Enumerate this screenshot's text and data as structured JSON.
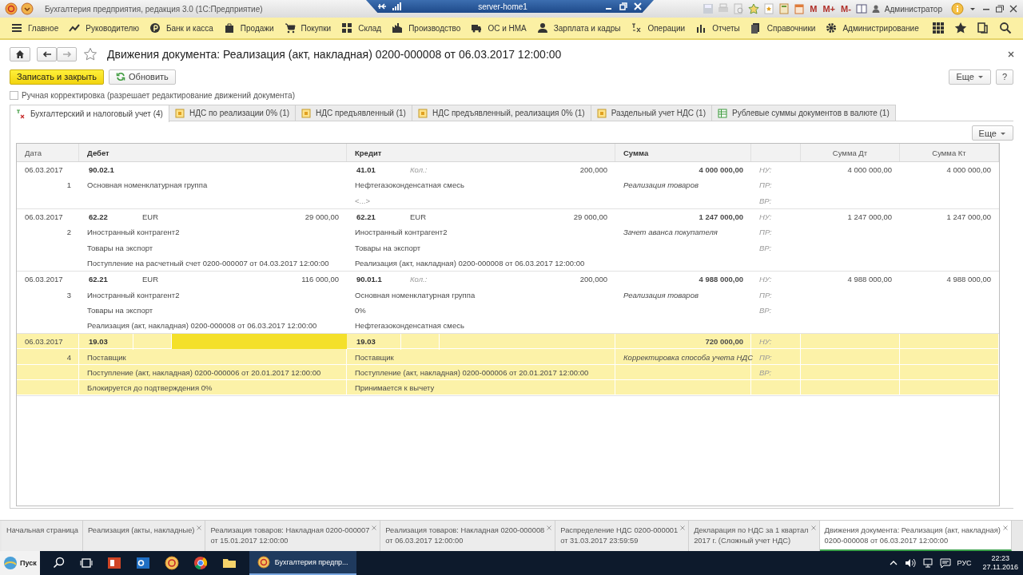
{
  "window": {
    "title": "Бухгалтерия предприятия, редакция 3.0  (1С:Предприятие)",
    "remote_host": "server-home1",
    "memory_buttons": [
      "M",
      "M+",
      "M-"
    ],
    "user": "Администратор"
  },
  "sections": [
    "Главное",
    "Руководителю",
    "Банк и касса",
    "Продажи",
    "Покупки",
    "Склад",
    "Производство",
    "ОС и НМА",
    "Зарплата и кадры",
    "Операции",
    "Отчеты",
    "Справочники",
    "Администрирование"
  ],
  "form": {
    "title": "Движения документа: Реализация (акт, накладная) 0200-000008 от 06.03.2017 12:00:00",
    "favorite": false,
    "buttons": {
      "save_close": "Записать и закрыть",
      "refresh": "Обновить",
      "more": "Еще",
      "help": "?",
      "table_more": "Еще"
    },
    "manual_edit": {
      "label": "Ручная корректировка (разрешает редактирование движений документа)",
      "checked": false
    },
    "tabs": [
      {
        "label": "Бухгалтерский и налоговый учет (4)",
        "selected": true
      },
      {
        "label": "НДС по реализации 0% (1)",
        "selected": false
      },
      {
        "label": "НДС предъявленный (1)",
        "selected": false
      },
      {
        "label": "НДС предъявленный, реализация 0% (1)",
        "selected": false
      },
      {
        "label": "Раздельный учет НДС (1)",
        "selected": false
      },
      {
        "label": "Рублевые суммы документов в валюте (1)",
        "selected": false
      }
    ],
    "table": {
      "columns": [
        "Дата",
        "Дебет",
        "Кредит",
        "Сумма",
        "",
        "Сумма Дт",
        "Сумма Кт"
      ],
      "entries": [
        {
          "date": "06.03.2017",
          "number": "1",
          "selected": false,
          "debit": {
            "account": "90.02.1",
            "lines": [
              {
                "text": "Основная номенклатурная группа",
                "muted": false
              }
            ]
          },
          "credit": {
            "account": "41.01",
            "qty_label": "Кол.:",
            "qty": "200,000",
            "lines": [
              {
                "text": "Нефтегазоконденсатная смесь",
                "muted": false
              },
              {
                "text": "<...>",
                "muted": true
              }
            ]
          },
          "sum": "4 000 000,00",
          "content": "Реализация товаров",
          "tax_labels": [
            "НУ:",
            "ПР:",
            "ВР:"
          ],
          "sum_dt": "4 000 000,00",
          "sum_kt": "4 000 000,00"
        },
        {
          "date": "06.03.2017",
          "number": "2",
          "selected": false,
          "debit": {
            "account": "62.22",
            "currency": "EUR",
            "amount": "29 000,00",
            "lines": [
              {
                "text": "Иностранный контрагент2",
                "muted": false
              },
              {
                "text": "Товары на экспорт",
                "muted": false
              },
              {
                "text": "Поступление на расчетный счет 0200-000007 от 04.03.2017 12:00:00",
                "muted": false
              }
            ]
          },
          "credit": {
            "account": "62.21",
            "currency": "EUR",
            "amount": "29 000,00",
            "lines": [
              {
                "text": "Иностранный контрагент2",
                "muted": false
              },
              {
                "text": "Товары на экспорт",
                "muted": false
              },
              {
                "text": "Реализация (акт, накладная) 0200-000008 от 06.03.2017 12:00:00",
                "muted": false
              }
            ]
          },
          "sum": "1 247 000,00",
          "content": "Зачет аванса покупателя",
          "tax_labels": [
            "НУ:",
            "ПР:",
            "ВР:"
          ],
          "sum_dt": "1 247 000,00",
          "sum_kt": "1 247 000,00"
        },
        {
          "date": "06.03.2017",
          "number": "3",
          "selected": false,
          "debit": {
            "account": "62.21",
            "currency": "EUR",
            "amount": "116 000,00",
            "lines": [
              {
                "text": "Иностранный контрагент2",
                "muted": false
              },
              {
                "text": "Товары на экспорт",
                "muted": false
              },
              {
                "text": "Реализация (акт, накладная) 0200-000008 от 06.03.2017 12:00:00",
                "muted": false
              }
            ]
          },
          "credit": {
            "account": "90.01.1",
            "qty_label": "Кол.:",
            "qty": "200,000",
            "lines": [
              {
                "text": "Основная номенклатурная группа",
                "muted": false
              },
              {
                "text": "0%",
                "muted": false
              },
              {
                "text": "Нефтегазоконденсатная смесь",
                "muted": false
              }
            ]
          },
          "sum": "4 988 000,00",
          "content": "Реализация товаров",
          "tax_labels": [
            "НУ:",
            "ПР:",
            "ВР:"
          ],
          "sum_dt": "4 988 000,00",
          "sum_kt": "4 988 000,00"
        },
        {
          "date": "06.03.2017",
          "number": "4",
          "selected": true,
          "debit": {
            "account": "19.03",
            "lines": [
              {
                "text": "Поставщик",
                "muted": false
              },
              {
                "text": "Поступление (акт, накладная) 0200-000006 от 20.01.2017 12:00:00",
                "muted": false
              },
              {
                "text": "Блокируется до подтверждения 0%",
                "muted": false
              }
            ]
          },
          "credit": {
            "account": "19.03",
            "lines": [
              {
                "text": "Поставщик",
                "muted": false
              },
              {
                "text": "Поступление (акт, накладная) 0200-000006 от 20.01.2017 12:00:00",
                "muted": false
              },
              {
                "text": "Принимается к вычету",
                "muted": false
              }
            ]
          },
          "sum": "720 000,00",
          "content": "Корректировка способа учета НДС",
          "tax_labels": [
            "НУ:",
            "ПР:",
            "ВР:"
          ]
        }
      ]
    }
  },
  "open_windows": [
    {
      "lines": [
        "Начальная страница"
      ],
      "closable": false,
      "selected": false
    },
    {
      "lines": [
        "Реализация (акты, накладные)"
      ],
      "closable": true,
      "selected": false
    },
    {
      "lines": [
        "Реализация товаров: Накладная 0200-000007",
        "от 15.01.2017 12:00:00"
      ],
      "closable": true,
      "selected": false
    },
    {
      "lines": [
        "Реализация товаров: Накладная 0200-000008",
        "от 06.03.2017 12:00:00"
      ],
      "closable": true,
      "selected": false
    },
    {
      "lines": [
        "Распределение НДС 0200-000001",
        "от 31.03.2017 23:59:59"
      ],
      "closable": true,
      "selected": false
    },
    {
      "lines": [
        "Декларация по НДС за 1 квартал",
        "2017 г. (Сложный учет НДС)"
      ],
      "closable": true,
      "selected": false
    },
    {
      "lines": [
        "Движения документа: Реализация (акт, накладная)",
        "0200-000008 от 06.03.2017 12:00:00"
      ],
      "closable": true,
      "selected": true
    }
  ],
  "taskbar": {
    "start": "Пуск",
    "active_app": "Бухгалтерия предпр...",
    "language": "РУС",
    "time": "22:23",
    "date": "27.11.2016"
  }
}
